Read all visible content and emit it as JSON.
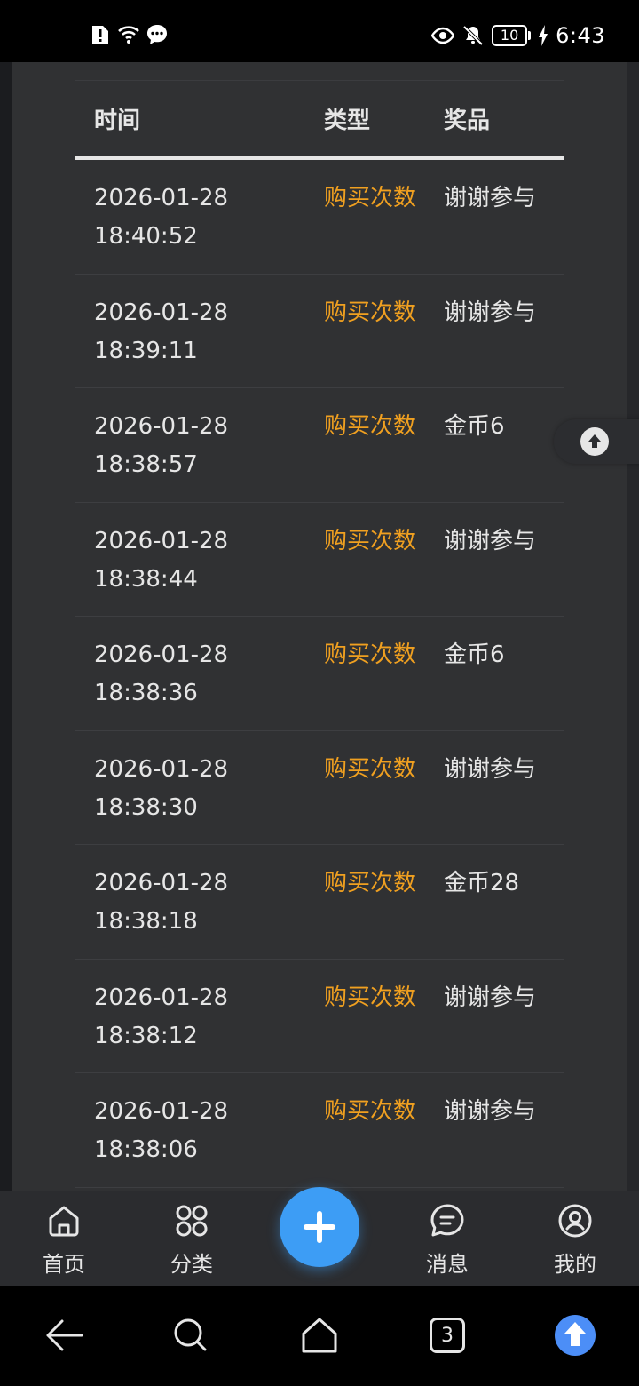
{
  "status_bar": {
    "time": "6:43",
    "battery_level": "10"
  },
  "table": {
    "headers": {
      "time": "时间",
      "type": "类型",
      "prize": "奖品"
    },
    "rows": [
      {
        "date": "2026-01-28",
        "time": "18:40:52",
        "type": "购买次数",
        "prize": "谢谢参与"
      },
      {
        "date": "2026-01-28",
        "time": "18:39:11",
        "type": "购买次数",
        "prize": "谢谢参与"
      },
      {
        "date": "2026-01-28",
        "time": "18:38:57",
        "type": "购买次数",
        "prize": "金币6"
      },
      {
        "date": "2026-01-28",
        "time": "18:38:44",
        "type": "购买次数",
        "prize": "谢谢参与"
      },
      {
        "date": "2026-01-28",
        "time": "18:38:36",
        "type": "购买次数",
        "prize": "金币6"
      },
      {
        "date": "2026-01-28",
        "time": "18:38:30",
        "type": "购买次数",
        "prize": "谢谢参与"
      },
      {
        "date": "2026-01-28",
        "time": "18:38:18",
        "type": "购买次数",
        "prize": "金币28"
      },
      {
        "date": "2026-01-28",
        "time": "18:38:12",
        "type": "购买次数",
        "prize": "谢谢参与"
      },
      {
        "date": "2026-01-28",
        "time": "18:38:06",
        "type": "购买次数",
        "prize": "谢谢参与"
      }
    ]
  },
  "tabbar": {
    "home": "首页",
    "category": "分类",
    "messages": "消息",
    "mine": "我的"
  },
  "navbar": {
    "tab_count": "3"
  },
  "colors": {
    "accent": "#3d9df5",
    "type_text": "#f0a020",
    "card_bg": "#303133"
  }
}
